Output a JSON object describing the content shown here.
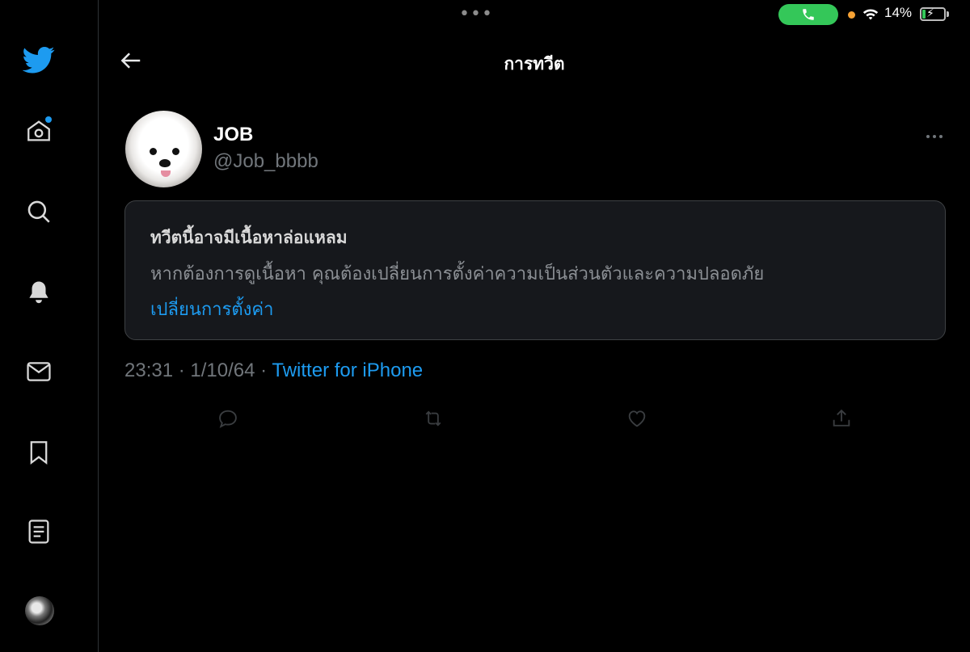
{
  "status_bar": {
    "battery_percent": "14%",
    "battery_level": 0.14,
    "accent": "#34c759"
  },
  "header": {
    "title": "การทวีต"
  },
  "tweet": {
    "display_name": "JOB",
    "handle": "@Job_bbbb",
    "warning": {
      "title": "ทวีตนี้อาจมีเนื้อหาล่อแหลม",
      "text": "หากต้องการดูเนื้อหา คุณต้องเปลี่ยนการตั้งค่าความเป็นส่วนตัวและความปลอดภัย",
      "link": "เปลี่ยนการตั้งค่า"
    },
    "time": "23:31",
    "separator": "·",
    "date": "1/10/64",
    "source": "Twitter for iPhone"
  },
  "sidebar": {
    "items": [
      "twitter-logo-icon",
      "home-icon",
      "search-icon",
      "bell-icon",
      "mail-icon",
      "bookmark-icon",
      "list-icon",
      "avatar"
    ]
  },
  "actions": [
    "reply-icon",
    "retweet-icon",
    "like-icon",
    "share-icon"
  ],
  "colors": {
    "background": "#000000",
    "accent": "#1d9bf0",
    "muted": "#71767b"
  }
}
